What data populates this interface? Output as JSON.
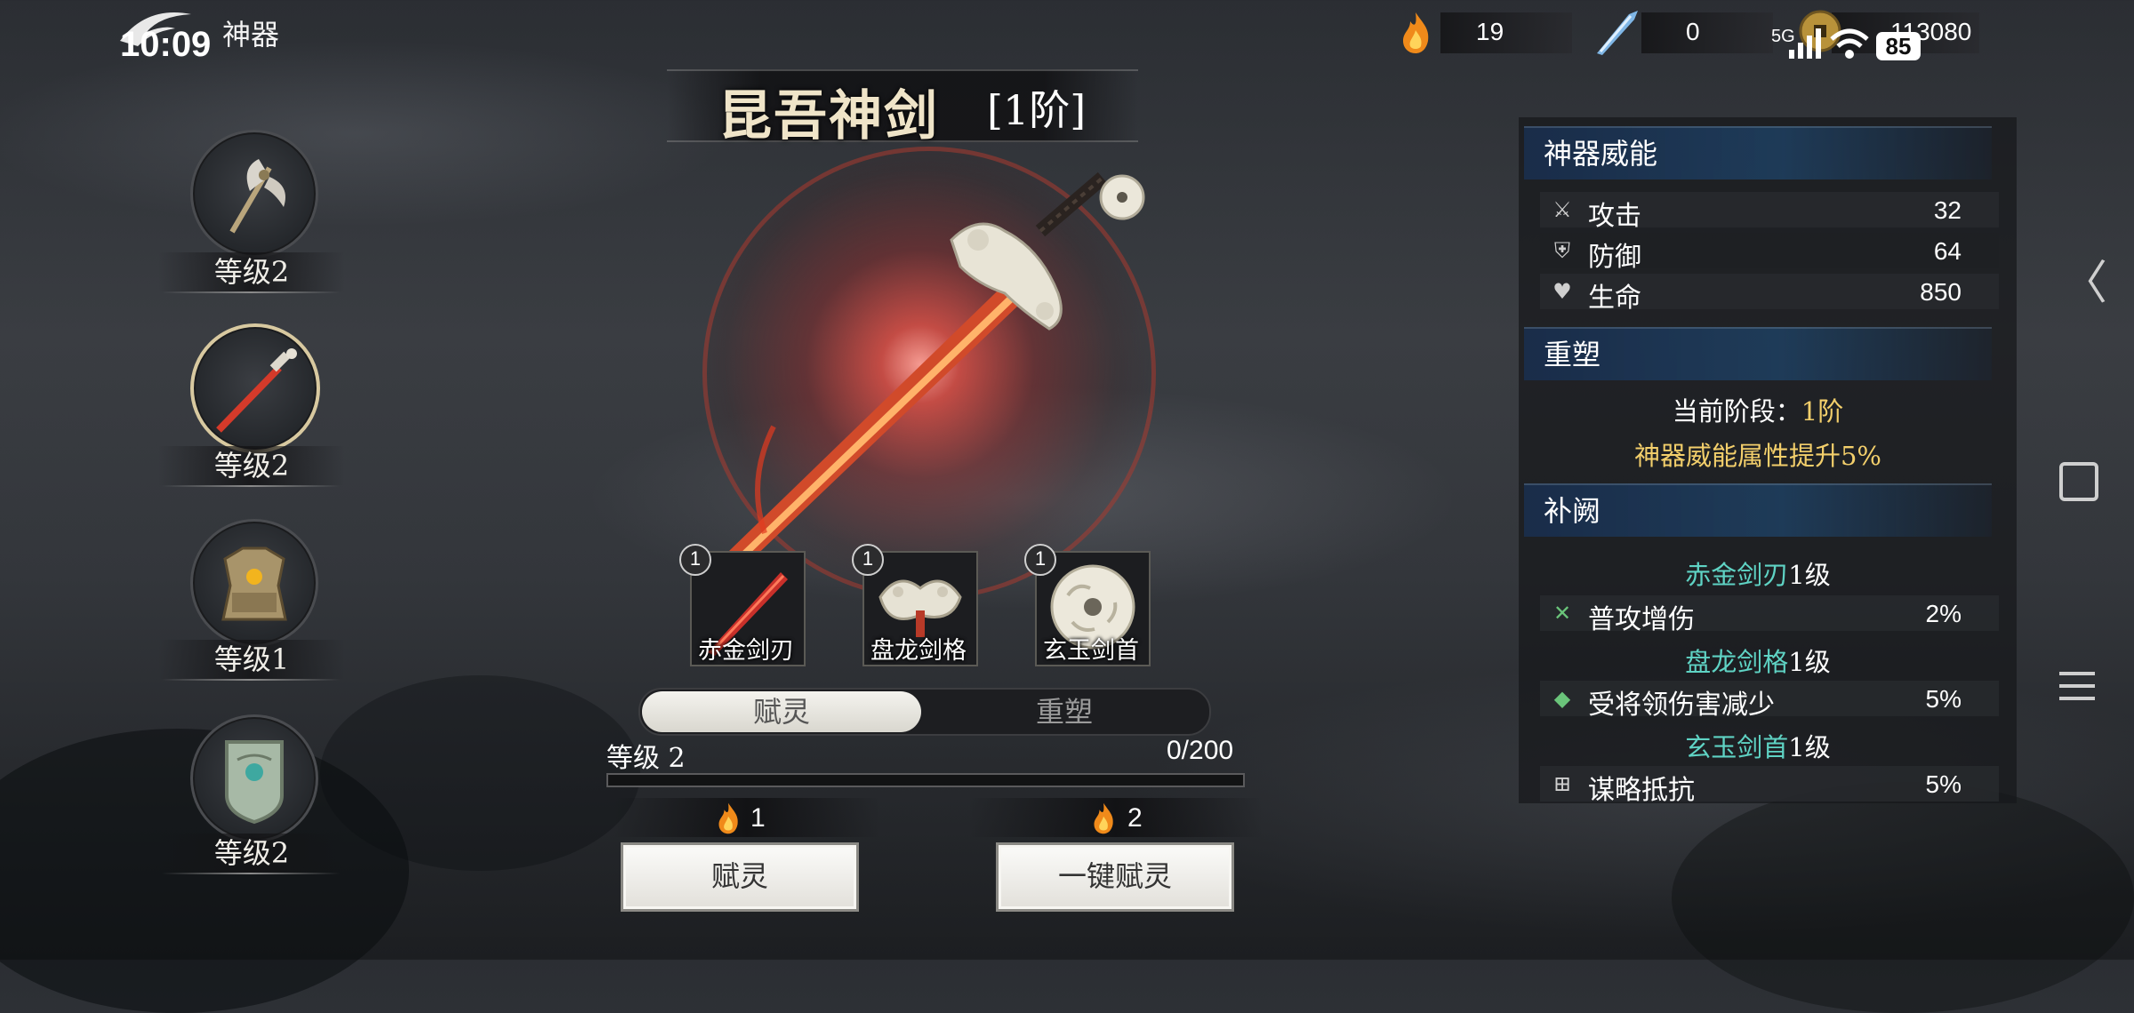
{
  "status_bar": {
    "time": "10:09",
    "network": "5G",
    "battery": "85"
  },
  "header": {
    "title": "神器",
    "resources": [
      {
        "icon": "flame-icon",
        "value": "19"
      },
      {
        "icon": "crystal-blade-icon",
        "value": "0"
      },
      {
        "icon": "coin-icon",
        "value": "113080"
      }
    ]
  },
  "artifacts": [
    {
      "icon": "battle-axe-icon",
      "level": "等级2",
      "selected": false
    },
    {
      "icon": "red-sword-icon",
      "level": "等级2",
      "selected": true
    },
    {
      "icon": "armor-icon",
      "level": "等级1",
      "selected": false
    },
    {
      "icon": "shield-icon",
      "level": "等级2",
      "selected": false
    }
  ],
  "weapon": {
    "name": "昆吾神剑",
    "rank": "[1阶]",
    "parts": [
      {
        "num": "1",
        "name": "赤金剑刃",
        "icon": "blade-part-icon"
      },
      {
        "num": "1",
        "name": "盘龙剑格",
        "icon": "dragon-guard-icon"
      },
      {
        "num": "1",
        "name": "玄玉剑首",
        "icon": "jade-pommel-icon"
      }
    ]
  },
  "tabs": {
    "active": "赋灵",
    "inactive": "重塑"
  },
  "level": {
    "label": "等级 2",
    "progress_text": "0/200",
    "progress_fraction": 0
  },
  "costs": {
    "single": "1",
    "auto": "2"
  },
  "buttons": {
    "single": "赋灵",
    "auto": "一键赋灵"
  },
  "panel": {
    "power_title": "神器威能",
    "stats": [
      {
        "icon": "sword-icon",
        "name": "攻击",
        "value": "32"
      },
      {
        "icon": "armor-small-icon",
        "name": "防御",
        "value": "64"
      },
      {
        "icon": "heart-icon",
        "name": "生命",
        "value": "850"
      }
    ],
    "reshape_title": "重塑",
    "stage_label": "当前阶段：",
    "stage_value": "1阶",
    "bonus_text": "神器威能属性提升5%",
    "patch_title": "补阙",
    "patch_items": [
      {
        "part": "赤金剑刃",
        "lvl": "1级",
        "icon": "crossed-swords-icon",
        "effect": "普攻增伤",
        "value": "2%"
      },
      {
        "part": "盘龙剑格",
        "lvl": "1级",
        "icon": "general-icon",
        "effect": "受将领伤害减少",
        "value": "5%"
      },
      {
        "part": "玄玉剑首",
        "lvl": "1级",
        "icon": "strategy-icon",
        "effect": "谋略抵抗",
        "value": "5%"
      }
    ]
  },
  "colors": {
    "accent_gold": "#f3cf6b",
    "accent_teal": "#5fd3c4",
    "section_blue": "#1e466e"
  }
}
